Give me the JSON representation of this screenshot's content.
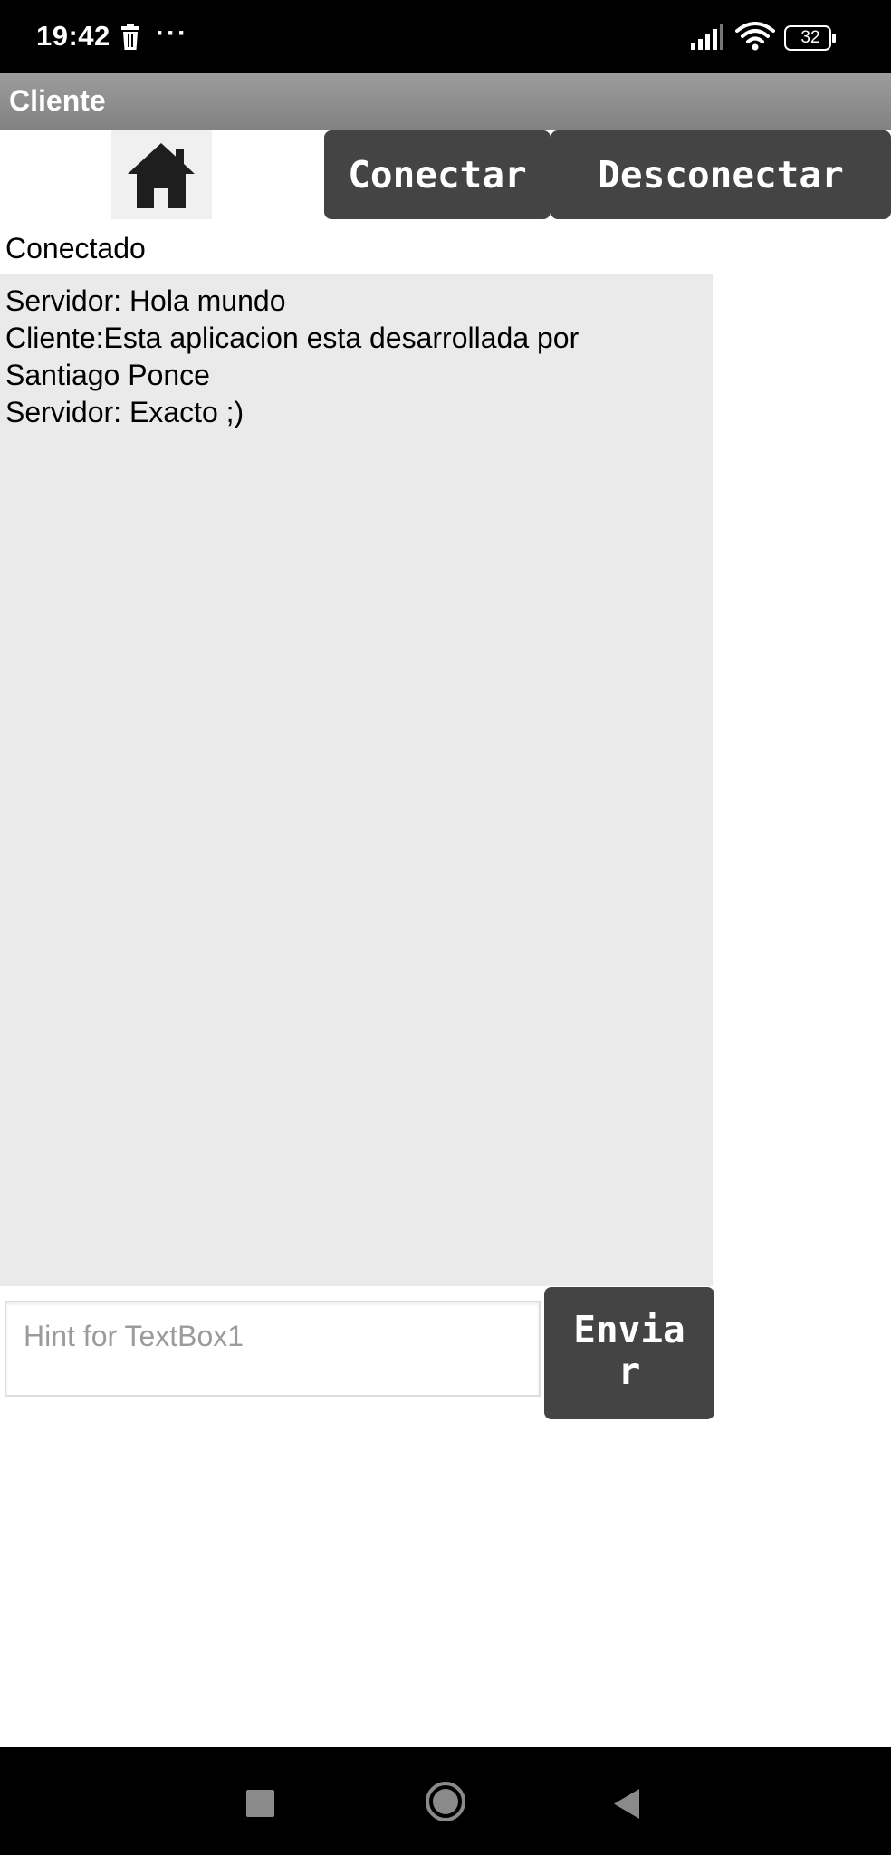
{
  "status_bar": {
    "time": "19:42",
    "dots": "···",
    "battery": "32",
    "icons": [
      "trash-icon",
      "more-dots-icon",
      "signal-icon",
      "wifi-icon",
      "battery-icon"
    ]
  },
  "app": {
    "title": "Cliente"
  },
  "toolbar": {
    "home_icon": "home-icon",
    "connect_label": "Conectar",
    "disconnect_label": "Desconectar"
  },
  "status": {
    "label": "Conectado"
  },
  "chat": {
    "lines": [
      "Servidor: Hola mundo",
      "Cliente:Esta aplicacion esta desarrollada por",
      "Santiago Ponce",
      "Servidor: Exacto ;)"
    ]
  },
  "composer": {
    "placeholder": "Hint for TextBox1",
    "send_line1": "Envia",
    "send_line2": "r"
  },
  "nav_bar": {
    "icons": [
      "recent-apps-icon",
      "home-circle-icon",
      "back-triangle-icon"
    ]
  },
  "colors": {
    "button_bg": "#444444",
    "chat_bg": "#eaeaea",
    "titlebar_bg": "#8f8f8f"
  }
}
